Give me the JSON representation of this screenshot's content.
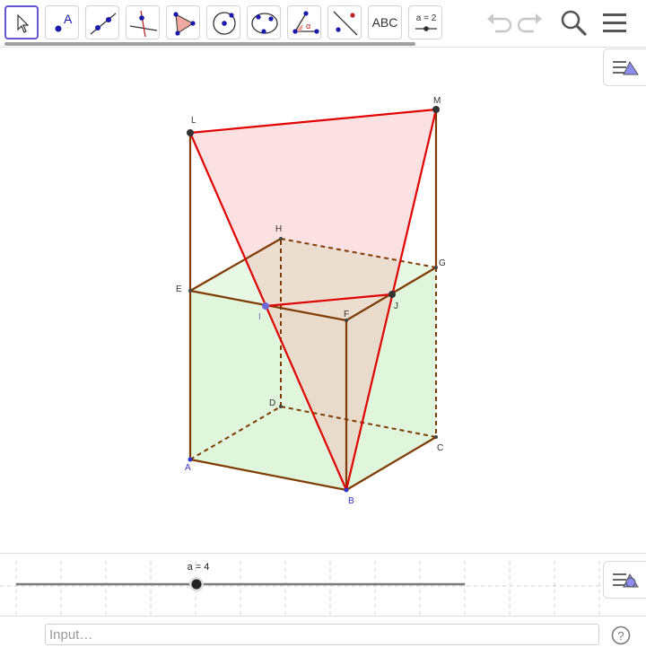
{
  "toolbar": {
    "tools": [
      {
        "name": "move",
        "selected": true
      },
      {
        "name": "point",
        "label": "A"
      },
      {
        "name": "line"
      },
      {
        "name": "perpendicular-line"
      },
      {
        "name": "polygon"
      },
      {
        "name": "circle-center-point"
      },
      {
        "name": "circle-three-points"
      },
      {
        "name": "angle",
        "label": "α"
      },
      {
        "name": "reflect"
      },
      {
        "name": "text",
        "label": "ABC"
      },
      {
        "name": "slider",
        "label": "a = 2"
      }
    ],
    "icons": [
      "undo-icon",
      "redo-icon",
      "search-icon",
      "menu-icon"
    ]
  },
  "figure": {
    "labels": {
      "A": "A",
      "B": "B",
      "C": "C",
      "D": "D",
      "E": "E",
      "F": "F",
      "G": "G",
      "H": "H",
      "I": "I",
      "J": "J",
      "L": "L",
      "M": "M"
    },
    "colors": {
      "edges": "#7f3b00",
      "section": "#e00000",
      "triangle_fill": "#f4b3b3",
      "cube_fill": "#c9f0c4",
      "point": "#333333",
      "base_point": "#3333cc"
    }
  },
  "slider": {
    "label": "a = 4",
    "value": 4
  },
  "input": {
    "placeholder": "Input…"
  }
}
